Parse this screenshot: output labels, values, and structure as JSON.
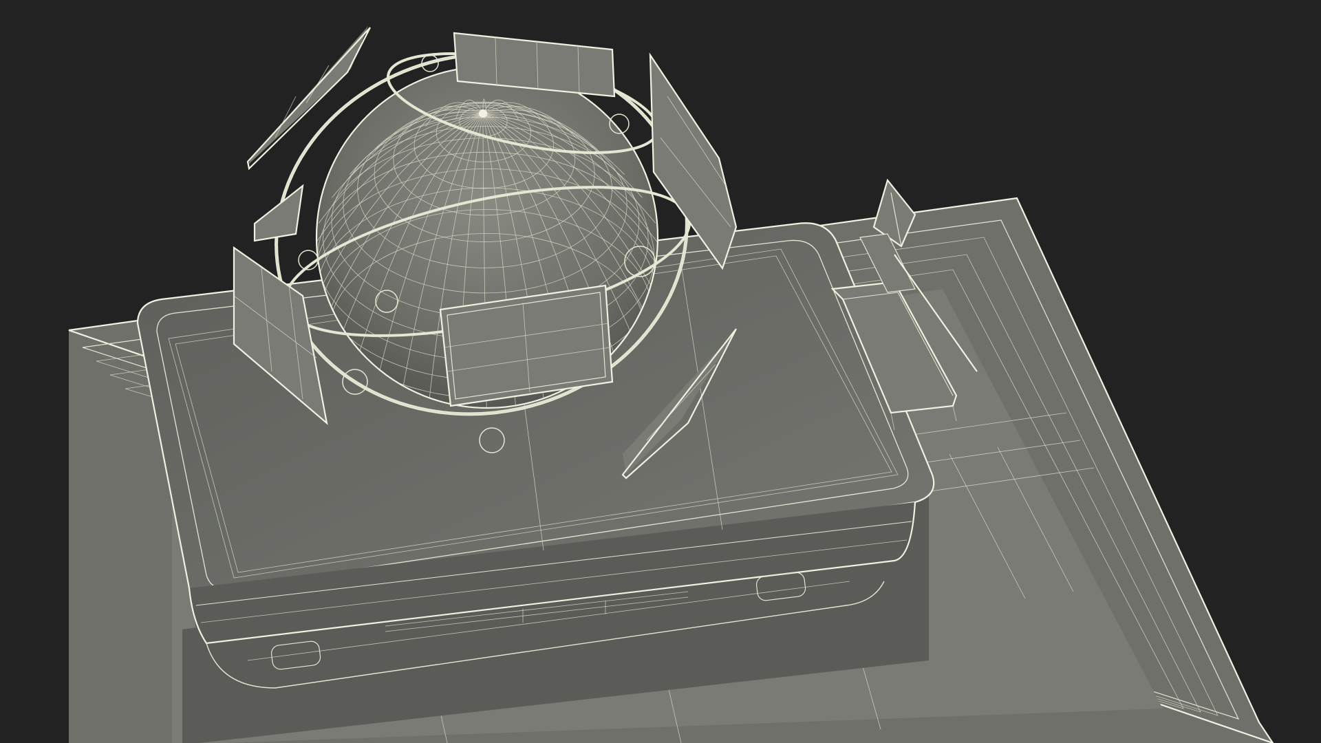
{
  "scene": {
    "background_color": "#222222",
    "surface_color": "#6f706a",
    "wire_color": "#e6e6d4",
    "objects": [
      {
        "name": "base-plate",
        "description_icon": "wireframe-base-plate"
      },
      {
        "name": "table-tray",
        "description_icon": "wireframe-tray"
      },
      {
        "name": "globe",
        "description_icon": "wireframe-globe"
      },
      {
        "name": "orbit-rings",
        "description_icon": "wireframe-orbit"
      },
      {
        "name": "satellite-panels",
        "description_icon": "wireframe-panel"
      },
      {
        "name": "side-module",
        "description_icon": "wireframe-module"
      },
      {
        "name": "flag-marker",
        "description_icon": "wireframe-flag"
      }
    ]
  }
}
